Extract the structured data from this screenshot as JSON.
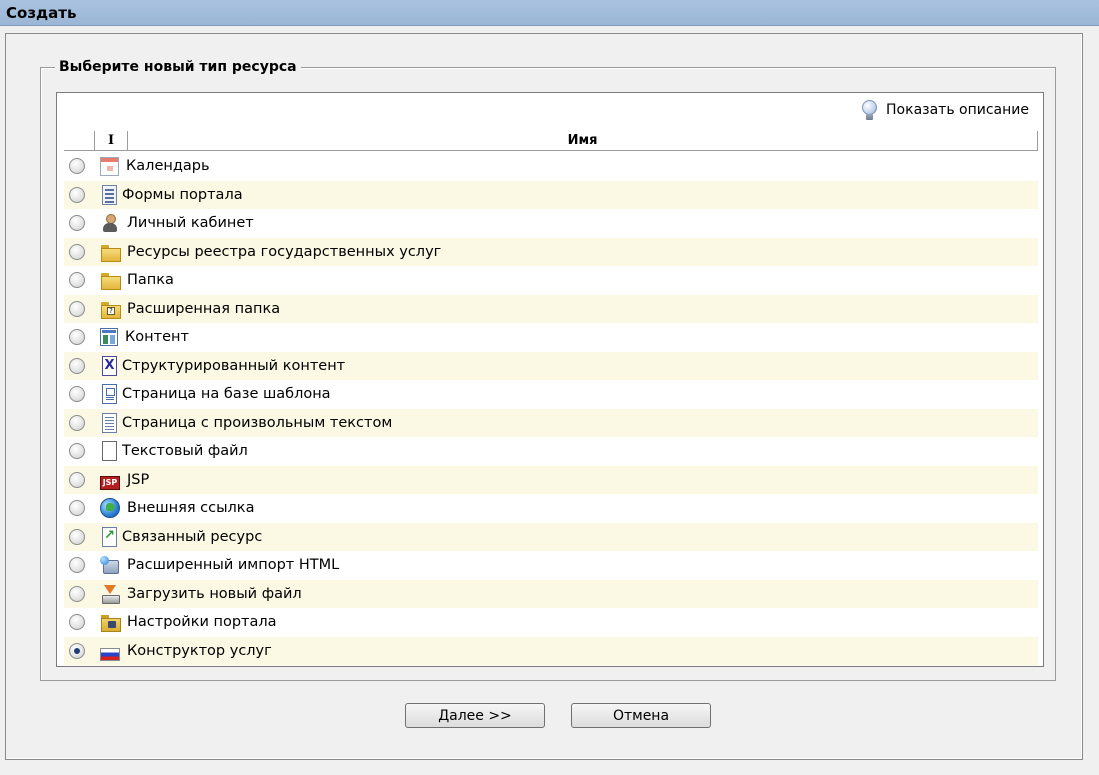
{
  "window": {
    "title": "Создать"
  },
  "group": {
    "legend": "Выберите новый тип ресурса"
  },
  "toolbar": {
    "show_description": "Показать описание",
    "icon": "lightbulb-icon"
  },
  "table": {
    "headers": {
      "type": "I",
      "name": "Имя"
    },
    "rows": [
      {
        "label": "Календарь",
        "icon": "calendar-icon",
        "checked": false
      },
      {
        "label": "Формы портала",
        "icon": "forms-icon",
        "checked": false
      },
      {
        "label": "Личный кабинет",
        "icon": "user-icon",
        "checked": false
      },
      {
        "label": "Ресурсы реестра государственных услуг",
        "icon": "folder-icon",
        "checked": false
      },
      {
        "label": "Папка",
        "icon": "folder-icon",
        "checked": false
      },
      {
        "label": "Расширенная папка",
        "icon": "extended-folder-icon",
        "checked": false
      },
      {
        "label": "Контент",
        "icon": "content-icon",
        "checked": false
      },
      {
        "label": "Структурированный контент",
        "icon": "xml-icon",
        "checked": false
      },
      {
        "label": "Страница на базе шаблона",
        "icon": "template-page-icon",
        "checked": false
      },
      {
        "label": "Страница с произвольным текстом",
        "icon": "text-page-icon",
        "checked": false
      },
      {
        "label": "Текстовый файл",
        "icon": "file-icon",
        "checked": false
      },
      {
        "label": "JSP",
        "icon": "jsp-icon",
        "checked": false
      },
      {
        "label": "Внешняя ссылка",
        "icon": "globe-icon",
        "checked": false
      },
      {
        "label": "Связанный ресурс",
        "icon": "link-icon",
        "checked": false
      },
      {
        "label": "Расширенный импорт HTML",
        "icon": "import-icon",
        "checked": false
      },
      {
        "label": "Загрузить новый файл",
        "icon": "upload-icon",
        "checked": false
      },
      {
        "label": "Настройки портала",
        "icon": "settings-folder-icon",
        "checked": false
      },
      {
        "label": "Конструктор услуг",
        "icon": "flag-icon",
        "checked": true
      }
    ]
  },
  "buttons": {
    "next": "Далее >>",
    "cancel": "Отмена"
  },
  "colors": {
    "titlebar": "#a9c2df",
    "row_alt": "#fbf9e3",
    "background": "#f0f0f0"
  }
}
